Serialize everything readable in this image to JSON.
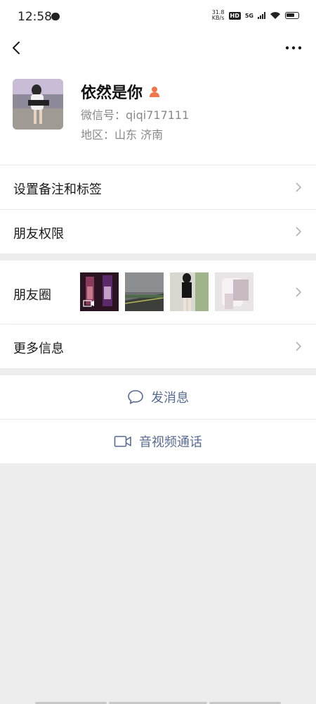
{
  "status": {
    "time": "12:58",
    "net_speed_value": "31.8",
    "net_speed_unit": "KB/s",
    "hd": "HD",
    "network": "5G"
  },
  "profile": {
    "nickname": "依然是你",
    "wechat_id": "微信号：qiqi717111",
    "region": "地区：山东  济南",
    "gender_color": "#f0764b"
  },
  "menu": {
    "remark_tags": "设置备注和标签",
    "friend_permissions": "朋友权限",
    "moments": "朋友圈",
    "more_info": "更多信息"
  },
  "actions": {
    "send_message": "发消息",
    "video_call": "音视频通话"
  },
  "colors": {
    "link": "#576b95",
    "background": "#ededed"
  }
}
